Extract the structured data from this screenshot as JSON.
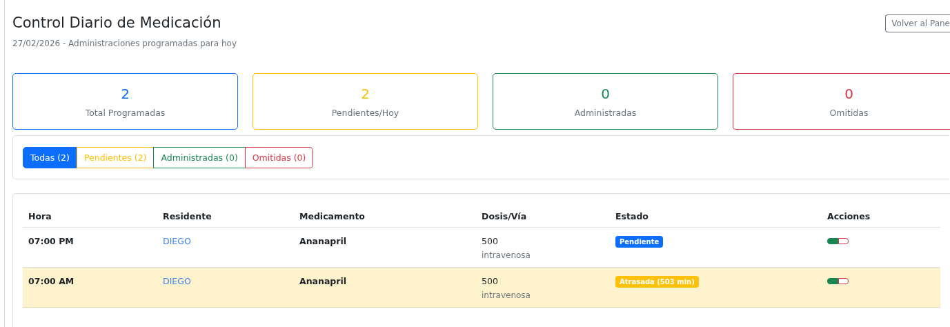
{
  "header": {
    "title": "Control Diario de Medicación",
    "subtitle": "27/02/2026 - Administraciones programadas para hoy",
    "back_button": "Volver al Pane"
  },
  "stats": [
    {
      "value": "2",
      "label": "Total Programadas",
      "color": "#0d6efd"
    },
    {
      "value": "2",
      "label": "Pendientes/Hoy",
      "color": "#ffc107"
    },
    {
      "value": "0",
      "label": "Administradas",
      "color": "#198754"
    },
    {
      "value": "0",
      "label": "Omitidas",
      "color": "#dc3545"
    }
  ],
  "filters": [
    {
      "label": "Todas (2)",
      "selected": true,
      "color": "#0d6efd"
    },
    {
      "label": "Pendientes (2)",
      "selected": false,
      "color": "#ffc107"
    },
    {
      "label": "Administradas (0)",
      "selected": false,
      "color": "#198754"
    },
    {
      "label": "Omitidas (0)",
      "selected": false,
      "color": "#dc3545"
    }
  ],
  "table": {
    "columns": [
      "Hora",
      "Residente",
      "Medicamento",
      "Dosis/Vía",
      "Estado",
      "Acciones"
    ],
    "rows": [
      {
        "time": "07:00 PM",
        "resident": "DIEGO",
        "medication": "Ananapril",
        "dose": "500",
        "route": "intravenosa",
        "status": "Pendiente",
        "color": "#0d6efd",
        "highlighted": false
      },
      {
        "time": "07:00 AM",
        "resident": "DIEGO",
        "medication": "Ananapril",
        "dose": "500",
        "route": "intravenosa",
        "status": "Atrasada (503 min)",
        "color": "#ffc107",
        "highlighted": true
      }
    ]
  }
}
